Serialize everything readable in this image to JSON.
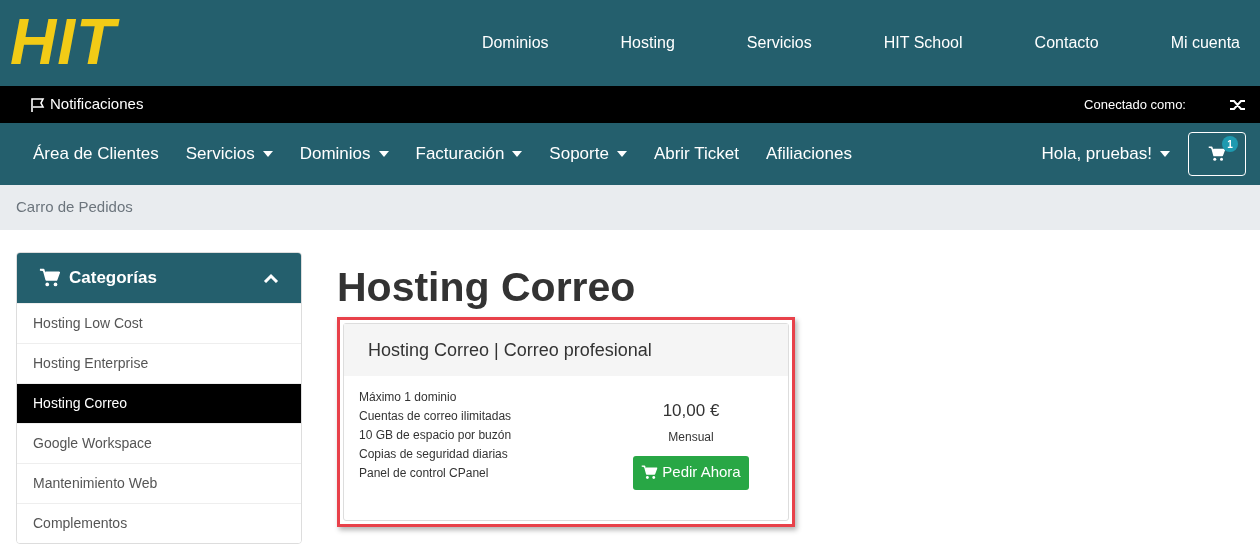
{
  "logo": "HIT",
  "top_nav": [
    "Dominios",
    "Hosting",
    "Servicios",
    "HIT School",
    "Contacto",
    "Mi cuenta"
  ],
  "notification_bar": {
    "notifications": "Notificaciones",
    "connected_as": "Conectado como:"
  },
  "main_nav": {
    "items": [
      {
        "label": "Área de Clientes",
        "dropdown": false
      },
      {
        "label": "Servicios",
        "dropdown": true
      },
      {
        "label": "Dominios",
        "dropdown": true
      },
      {
        "label": "Facturación",
        "dropdown": true
      },
      {
        "label": "Soporte",
        "dropdown": true
      },
      {
        "label": "Abrir Ticket",
        "dropdown": false
      },
      {
        "label": "Afiliaciones",
        "dropdown": false
      }
    ],
    "user": "Hola, pruebas!",
    "cart_count": "1"
  },
  "breadcrumb": "Carro de Pedidos",
  "sidebar": {
    "title": "Categorías",
    "expanded": true,
    "items": [
      {
        "label": "Hosting Low Cost",
        "selected": false
      },
      {
        "label": "Hosting Enterprise",
        "selected": false
      },
      {
        "label": "Hosting Correo",
        "selected": true
      },
      {
        "label": "Google Workspace",
        "selected": false
      },
      {
        "label": "Mantenimiento Web",
        "selected": false
      },
      {
        "label": "Complementos",
        "selected": false
      }
    ]
  },
  "page_title": "Hosting Correo",
  "product": {
    "highlighted": true,
    "name": "Hosting Correo | Correo profesional",
    "features": [
      "Máximo 1 dominio",
      "Cuentas de correo ilimitadas",
      "10 GB de espacio por buzón",
      "Copias de seguridad diarias",
      "Panel de control CPanel"
    ],
    "price": "10,00 €",
    "cycle": "Mensual",
    "order_button": "Pedir Ahora"
  }
}
